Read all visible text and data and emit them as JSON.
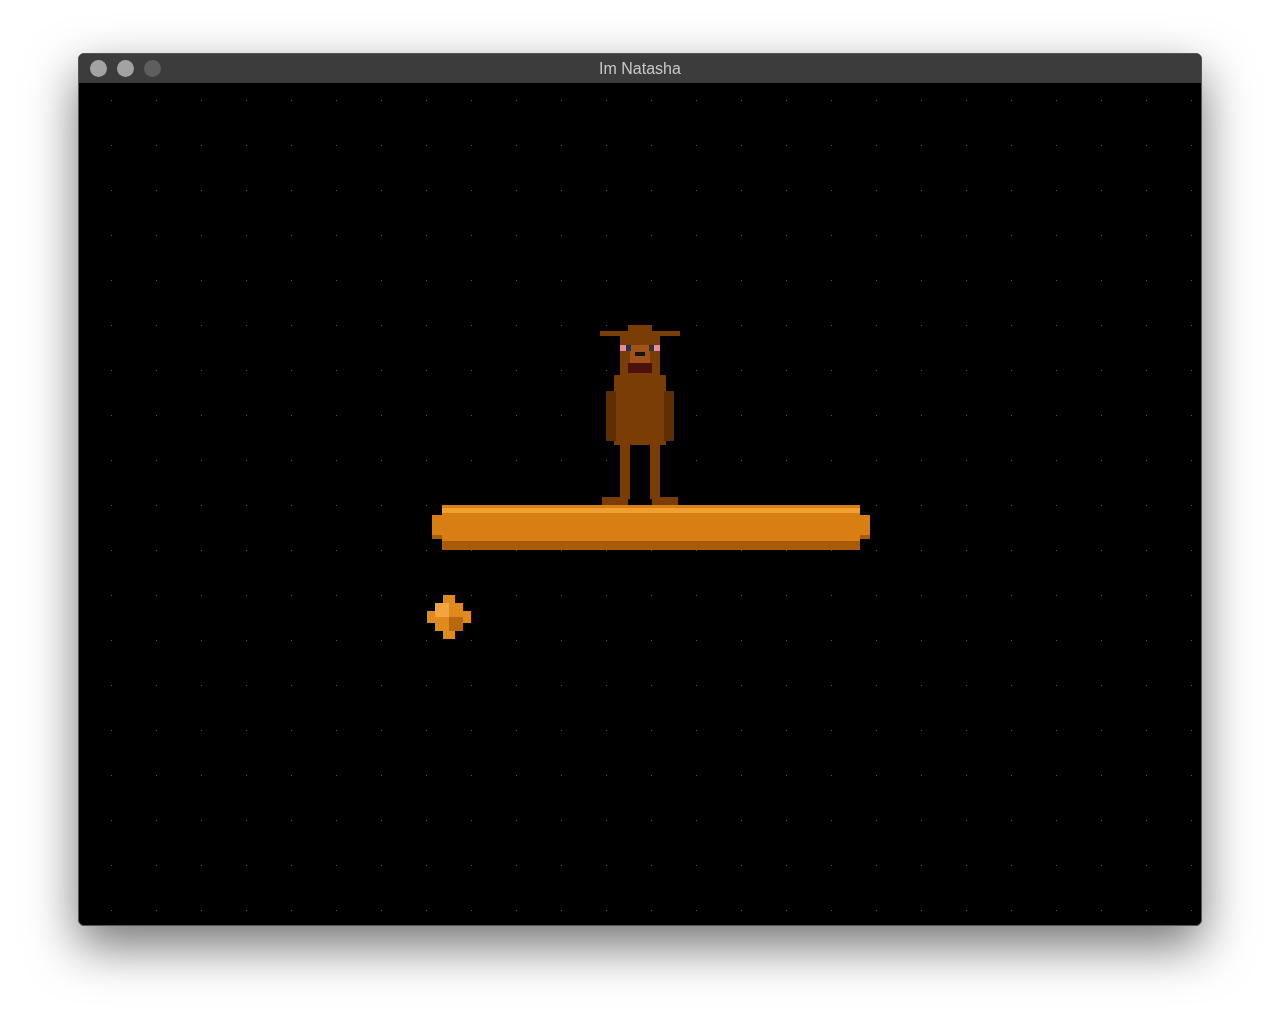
{
  "window": {
    "title": "Im Natasha",
    "buttons": [
      {
        "disabled": false
      },
      {
        "disabled": false
      },
      {
        "disabled": true
      }
    ]
  }
}
